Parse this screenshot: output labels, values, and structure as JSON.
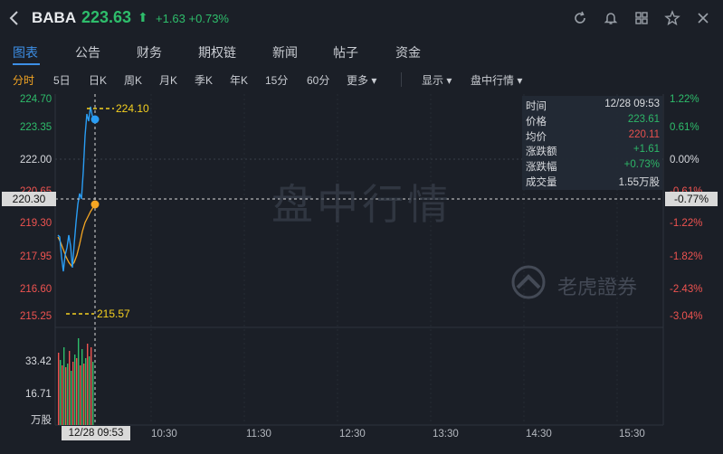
{
  "header": {
    "symbol": "BABA",
    "price": "223.63",
    "arrow": "⬆",
    "change": "+1.63",
    "change_pct": "+0.73%"
  },
  "tabs": [
    "图表",
    "公告",
    "财务",
    "期权链",
    "新闻",
    "帖子",
    "资金"
  ],
  "periods": [
    "分时",
    "5日",
    "日K",
    "周K",
    "月K",
    "季K",
    "年K",
    "15分",
    "60分",
    "更多 ▾"
  ],
  "right_menus": [
    "显示 ▾",
    "盘中行情 ▾"
  ],
  "left_axis": [
    "224.70",
    "223.35",
    "222.00",
    "220.65",
    "219.30",
    "217.95",
    "216.60",
    "215.25"
  ],
  "right_axis": [
    "1.22%",
    "0.61%",
    "0.00%",
    "-0.61%",
    "-1.22%",
    "-1.82%",
    "-2.43%",
    "-3.04%"
  ],
  "volume_axis": [
    "33.42",
    "16.71",
    "万股"
  ],
  "time_axis": [
    "10:30",
    "11:30",
    "12:30",
    "13:30",
    "14:30",
    "15:30"
  ],
  "high_label": "224.10",
  "low_label": "215.57",
  "crosshair": {
    "price": "220.30",
    "pct": "-0.77%",
    "time": "12/28 09:53"
  },
  "info_panel": [
    {
      "k": "时间",
      "v": "12/28 09:53",
      "color": "#e0e2e6"
    },
    {
      "k": "价格",
      "v": "223.61",
      "color": "#2ebd6b"
    },
    {
      "k": "均价",
      "v": "220.11",
      "color": "#ef5350"
    },
    {
      "k": "涨跌额",
      "v": "+1.61",
      "color": "#2ebd6b"
    },
    {
      "k": "涨跌幅",
      "v": "+0.73%",
      "color": "#2ebd6b"
    },
    {
      "k": "成交量",
      "v": "1.55万股",
      "color": "#e0e2e6"
    }
  ],
  "watermark": "盘中行情",
  "brand": "老虎證券",
  "colors": {
    "up": "#2ebd6b",
    "down": "#ef5350",
    "accent": "#3d8fe6",
    "line": "#2a9df4",
    "avg": "#f5a623"
  }
}
